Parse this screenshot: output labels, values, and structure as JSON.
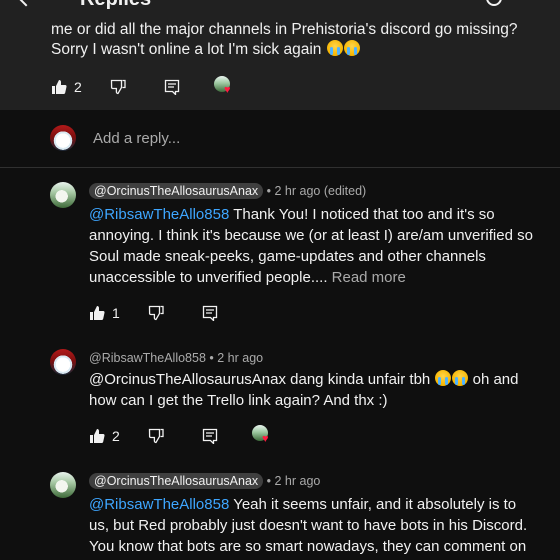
{
  "header": {
    "title": "Replies"
  },
  "parent_comment": {
    "text": "me or did all the major channels in Prehistoria's discord go missing? Sorry I wasn't online a lot I'm sick again",
    "like_count": "2"
  },
  "reply_input": {
    "placeholder": "Add a reply..."
  },
  "replies": [
    {
      "author": "@OrcinusTheAllosaurusAnax",
      "time": "• 2 hr ago (edited)",
      "mention": "@RibsawTheAllo858",
      "text": " Thank You! I noticed that too and it's so annoying. I think it's because we (or at least I) are/am unverified so Soul made sneak-peeks, game-updates and other channels unaccessible to unverified people.... ",
      "read_more": "Read more",
      "like_count": "1"
    },
    {
      "author": "@RibsawTheAllo858",
      "time": "• 2 hr ago",
      "mention": "@OrcinusTheAllosaurusAnax",
      "text_part1": "  dang kinda unfair tbh ",
      "text_part2": " oh and how can I get the Trello link again? And thx :)",
      "like_count": "2"
    },
    {
      "author": "@OrcinusTheAllosaurusAnax",
      "time": "• 2 hr ago",
      "mention": "@RibsawTheAllo858",
      "text": " Yeah it seems unfair, and it absolutely is to us, but Red probably just doesn't want to have bots in his Discord. You know that bots are so smart nowadays, they can comment on"
    }
  ],
  "colors": {
    "background": "#0f0f0f",
    "panel": "#212121",
    "mention": "#3ea6ff",
    "heart": "#ff1a40"
  }
}
